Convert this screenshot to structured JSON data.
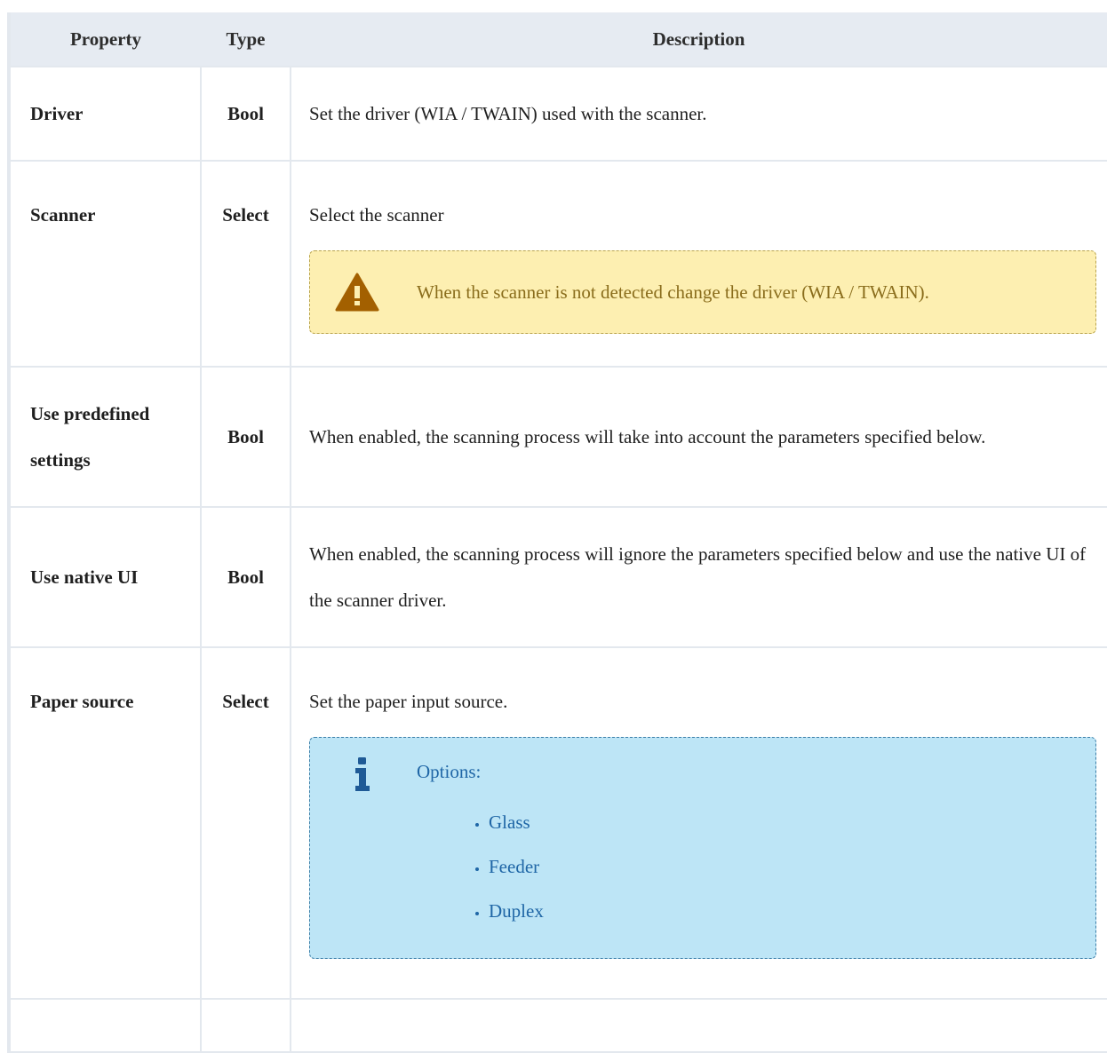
{
  "headers": {
    "property": "Property",
    "type": "Type",
    "description": "Description"
  },
  "rows": [
    {
      "property": "Driver",
      "type": "Bool",
      "description": "Set the driver (WIA / TWAIN) used with the scanner."
    },
    {
      "property": "Scanner",
      "type": "Select",
      "description": "Select the scanner",
      "warning": "When the scanner is not detected change the driver (WIA / TWAIN)."
    },
    {
      "property": "Use predefined settings",
      "type": "Bool",
      "description": "When enabled, the scanning process will take into account the parameters specified below."
    },
    {
      "property": "Use native UI",
      "type": "Bool",
      "description": "When enabled, the scanning process will ignore the parameters specified below and use the native UI of the scanner driver."
    },
    {
      "property": "Paper source",
      "type": "Select",
      "description": "Set the paper input source.",
      "info": {
        "title": "Options:",
        "options": [
          "Glass",
          "Feeder",
          "Duplex"
        ]
      }
    }
  ],
  "colors": {
    "header_bg": "#e6ebf2",
    "warning_bg": "#fdefb1",
    "warning_text": "#8a6d1c",
    "info_bg": "#bde5f6",
    "info_text": "#1f66a6"
  },
  "icons": {
    "warning": "warning-triangle-icon",
    "info": "info-icon"
  }
}
